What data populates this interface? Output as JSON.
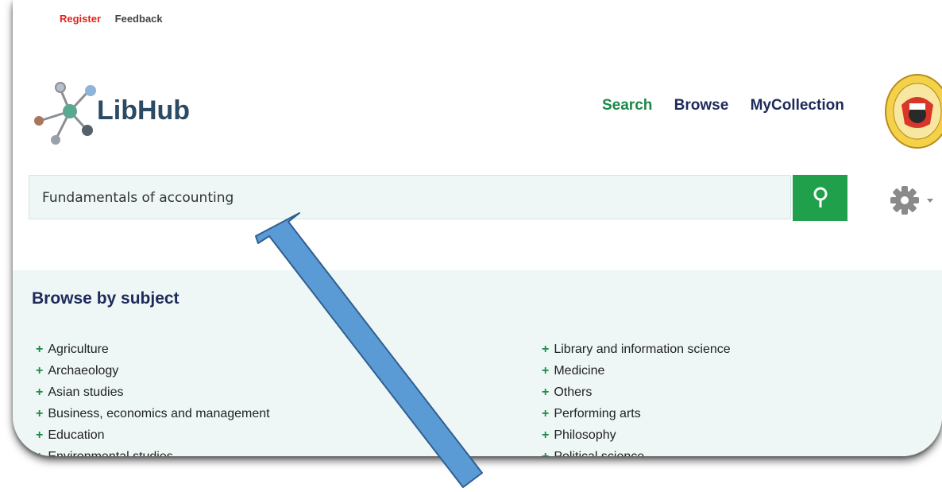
{
  "top_links": {
    "register": "Register",
    "feedback": "Feedback"
  },
  "logo": {
    "text": "LibHub"
  },
  "main_nav": {
    "search": "Search",
    "browse": "Browse",
    "my_collection": "MyCollection"
  },
  "search": {
    "value": "Fundamentals of accounting",
    "button_icon": "search-icon"
  },
  "settings": {
    "icon": "gear-icon"
  },
  "browse_by_subject": {
    "title": "Browse by subject",
    "left_items": [
      "Agriculture",
      "Archaeology",
      "Asian studies",
      "Business, economics and management",
      "Education",
      "Environmental studies"
    ],
    "right_items": [
      "Library and information science",
      "Medicine",
      "Others",
      "Performing arts",
      "Philosophy",
      "Political science"
    ]
  },
  "colors": {
    "accent_green": "#20a04a",
    "nav_dark": "#1e2a5a",
    "register_red": "#e3221b",
    "arrow_blue": "#5b9bd5"
  }
}
